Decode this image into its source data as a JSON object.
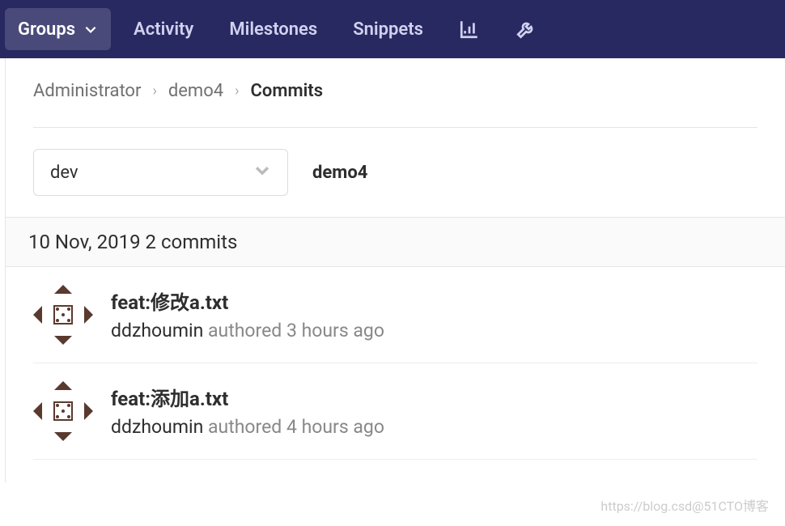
{
  "navbar": {
    "items": [
      {
        "label": "Groups",
        "active": true
      },
      {
        "label": "Activity"
      },
      {
        "label": "Milestones"
      },
      {
        "label": "Snippets"
      }
    ]
  },
  "breadcrumb": {
    "items": [
      "Administrator",
      "demo4",
      "Commits"
    ]
  },
  "branch": {
    "selected": "dev",
    "project": "demo4"
  },
  "date_header": {
    "date": "10 Nov, 2019",
    "count": "2 commits"
  },
  "commits": [
    {
      "title": "feat:修改a.txt",
      "author": "ddzhoumin",
      "authored": "authored 3 hours ago"
    },
    {
      "title": "feat:添加a.txt",
      "author": "ddzhoumin",
      "authored": "authored 4 hours ago"
    }
  ],
  "watermark": "https://blog.csd@51CTO博客"
}
